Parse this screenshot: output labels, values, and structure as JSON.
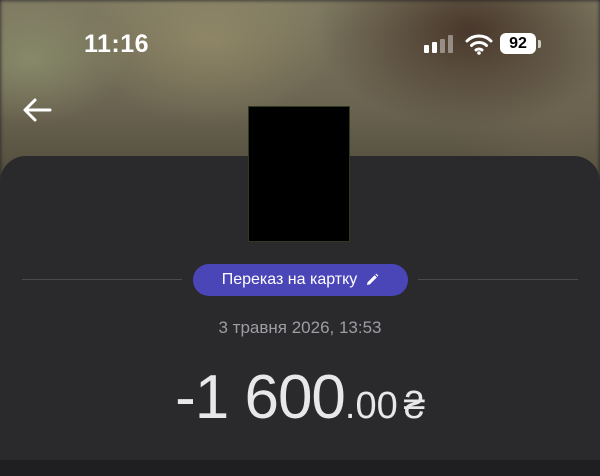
{
  "status_bar": {
    "time": "11:16",
    "battery": "92"
  },
  "transaction": {
    "category": "Переказ на картку",
    "date": "3 травня 2026, 13:53",
    "amount_main": "-1 600",
    "amount_cents": ".00",
    "currency": "₴"
  },
  "icons": {
    "back": "arrow-left-icon",
    "edit": "pencil-icon",
    "signal": "cellular-signal-icon",
    "wifi": "wifi-icon"
  },
  "colors": {
    "sheet": "#2a2a2c",
    "chip": "#4b46b8",
    "date_text": "#9d9da3",
    "amount_text": "#e8e8ea"
  }
}
